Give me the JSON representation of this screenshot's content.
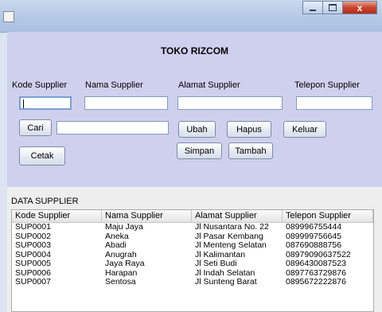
{
  "app": {
    "title": "TOKO RIZCOM"
  },
  "window": {
    "close_label": "x"
  },
  "form": {
    "labels": {
      "kode": "Kode Supplier",
      "nama": "Nama Supplier",
      "alamat": "Alamat Supplier",
      "telepon": "Telepon Supplier"
    },
    "values": {
      "kode": "",
      "nama": "",
      "alamat": "",
      "telepon": "",
      "cari": ""
    }
  },
  "buttons": {
    "cari": "Cari",
    "cetak": "Cetak",
    "ubah": "Ubah",
    "hapus": "Hapus",
    "keluar": "Keluar",
    "simpan": "Simpan",
    "tambah": "Tambah"
  },
  "table": {
    "caption": "DATA SUPPLIER",
    "columns": [
      "Kode Supplier",
      "Nama Supplier",
      "Alamat Supplier",
      "Telepon Supplier"
    ],
    "rows": [
      [
        "SUP0001",
        "Maju Jaya",
        "Jl Nusantara No. 22",
        "089996755444"
      ],
      [
        "SUP0002",
        "Aneka",
        "Jl Pasar Kembang",
        "089999756645"
      ],
      [
        "SUP0003",
        "Abadi",
        "Jl Menteng Selatan",
        "087690888756"
      ],
      [
        "SUP0004",
        "Anugrah",
        "Jl Kalimantan",
        "08979090637522"
      ],
      [
        "SUP0005",
        "Jaya Raya",
        "Jl Seti Budi",
        "0896430087523"
      ],
      [
        "SUP0006",
        "Harapan",
        "Jl Indah Selatan",
        "0897763729876"
      ],
      [
        "SUP0007",
        "Sentosa",
        "Jl Sunteng Barat",
        "0895672222876"
      ]
    ]
  }
}
